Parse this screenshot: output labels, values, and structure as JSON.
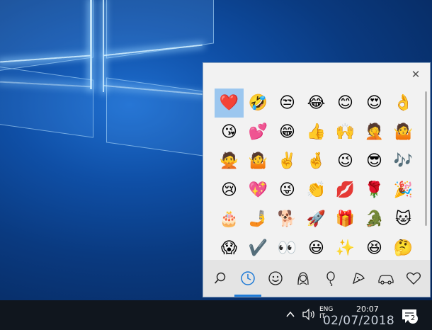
{
  "emoji_panel": {
    "close_label": "✕",
    "emojis": [
      "❤️",
      "🤣",
      "😒",
      "😂",
      "😊",
      "😍",
      "👌",
      "😘",
      "💕",
      "😁",
      "👍",
      "🙌",
      "🤦",
      "🤷",
      "🙅",
      "🤷",
      "✌️",
      "🤞",
      "😉",
      "😎",
      "🎶",
      "😢",
      "💖",
      "😜",
      "👏",
      "💋",
      "🌹",
      "🎉",
      "🎂",
      "🤳",
      "🐕",
      "🚀",
      "🎁",
      "🐊",
      "🐱",
      "😱",
      "✔️",
      "👀",
      "😃",
      "✨",
      "😆",
      "🤔"
    ],
    "categories": [
      {
        "name": "search",
        "icon": "search-icon"
      },
      {
        "name": "recent",
        "icon": "clock-icon"
      },
      {
        "name": "smileys",
        "icon": "smiley-icon"
      },
      {
        "name": "people",
        "icon": "person-icon"
      },
      {
        "name": "celebration",
        "icon": "balloon-icon"
      },
      {
        "name": "food",
        "icon": "pizza-icon"
      },
      {
        "name": "travel",
        "icon": "car-icon"
      },
      {
        "name": "symbols",
        "icon": "heart-icon"
      }
    ]
  },
  "taskbar": {
    "language": "ENG",
    "language_sub": "IT",
    "time": "20:07",
    "date": "02/07/2018",
    "notification_count": "2"
  },
  "colors": {
    "accent": "#1e7ad6",
    "selected_cell": "#9cc7ef",
    "taskbar": "#10161e"
  }
}
